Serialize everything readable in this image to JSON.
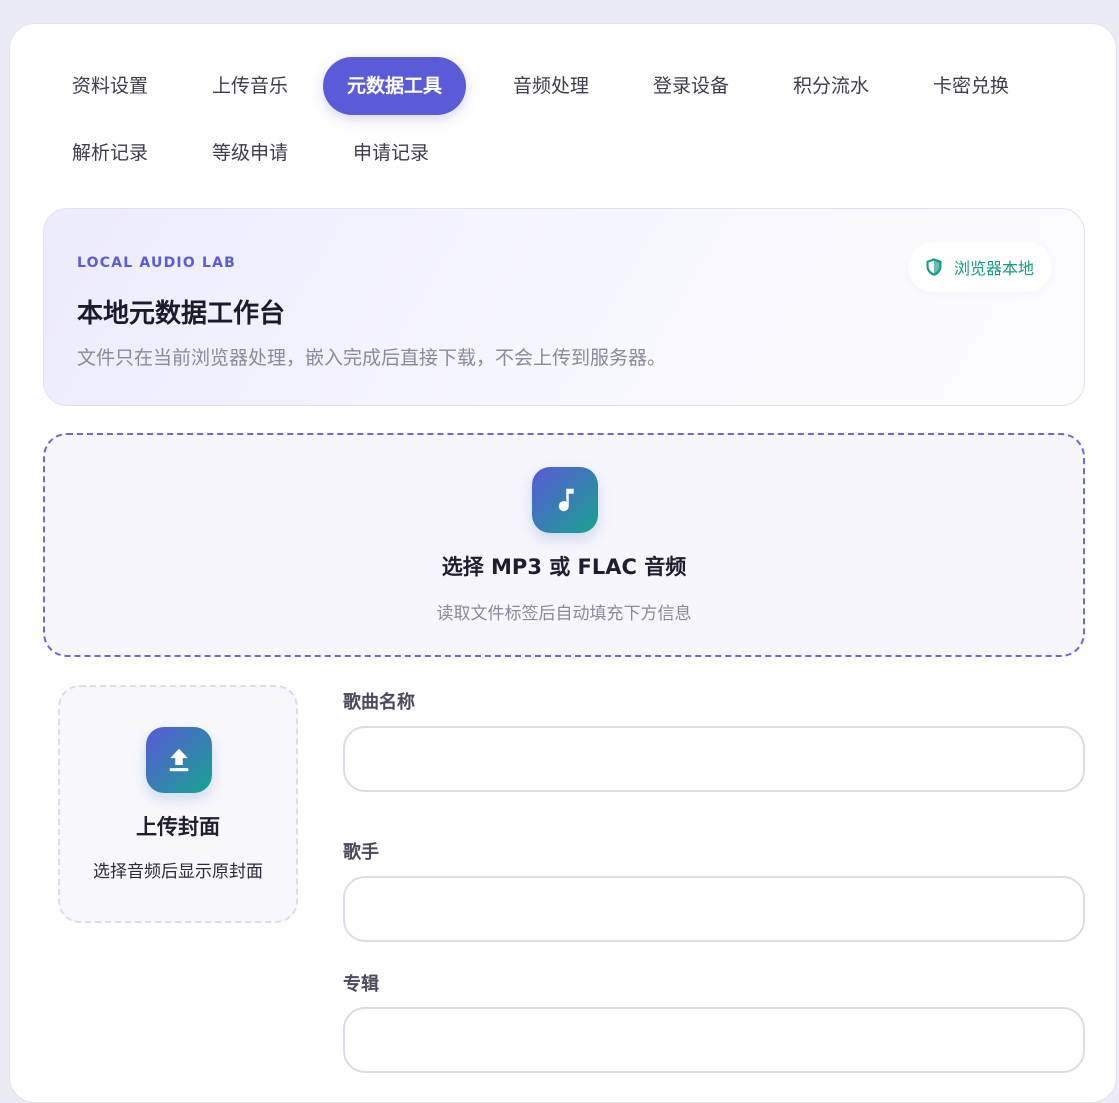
{
  "tabs": [
    {
      "label": "资料设置"
    },
    {
      "label": "上传音乐"
    },
    {
      "label": "元数据工具",
      "active": true
    },
    {
      "label": "音频处理"
    },
    {
      "label": "登录设备"
    },
    {
      "label": "积分流水"
    },
    {
      "label": "卡密兑换"
    },
    {
      "label": "解析记录"
    },
    {
      "label": "等级申请"
    },
    {
      "label": "申请记录"
    }
  ],
  "hero": {
    "eyebrow": "LOCAL AUDIO LAB",
    "title": "本地元数据工作台",
    "description": "文件只在当前浏览器处理，嵌入完成后直接下载，不会上传到服务器。",
    "badge": "浏览器本地",
    "badge_icon": "shield-icon"
  },
  "dropzone": {
    "icon": "music-note-icon",
    "title": "选择 MP3 或 FLAC 音频",
    "subtitle": "读取文件标签后自动填充下方信息"
  },
  "cover": {
    "icon": "upload-icon",
    "title": "上传封面",
    "subtitle": "选择音频后显示原封面"
  },
  "fields": {
    "song_name": {
      "label": "歌曲名称",
      "value": ""
    },
    "artist": {
      "label": "歌手",
      "value": ""
    },
    "album": {
      "label": "专辑",
      "value": ""
    }
  },
  "colors": {
    "accent": "#5b5bd9",
    "badge_text": "#159a86",
    "gradient_start": "#5a58d8",
    "gradient_end": "#17a38f"
  }
}
